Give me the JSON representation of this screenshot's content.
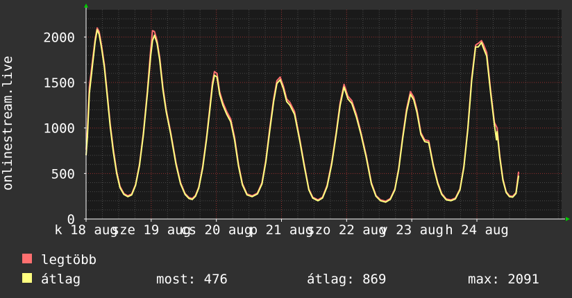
{
  "chart_data": {
    "type": "line",
    "ylabel": "onlinestream.live",
    "ylim": [
      0,
      2300
    ],
    "yticks": [
      0,
      500,
      1000,
      1500,
      2000
    ],
    "xlim": [
      0,
      7.3
    ],
    "xtick_labels": [
      {
        "pos": 0,
        "label": "k 18 aug"
      },
      {
        "pos": 1,
        "label": "sze 19 aug"
      },
      {
        "pos": 2,
        "label": "cs 20 aug"
      },
      {
        "pos": 3,
        "label": "p 21 aug"
      },
      {
        "pos": 4,
        "label": "szo 22 aug"
      },
      {
        "pos": 5,
        "label": "v 23 aug"
      },
      {
        "pos": 6,
        "label": "h 24 aug"
      }
    ],
    "colors": {
      "background": "#303030",
      "plot_bg": "#1a1a1a",
      "grid_major": "#ff4040",
      "grid_minor": "#4a4a4a",
      "max_series": "#ff7070",
      "avg_series": "#ffff80",
      "axis": "#ffffff",
      "arrow": "#00cc00",
      "text": "#ffffff"
    },
    "series": [
      {
        "name": "legtöbb",
        "color": "#ff7070",
        "points": [
          [
            0.0,
            760
          ],
          [
            0.02,
            980
          ],
          [
            0.05,
            1450
          ],
          [
            0.1,
            1750
          ],
          [
            0.14,
            1980
          ],
          [
            0.17,
            2100
          ],
          [
            0.2,
            2060
          ],
          [
            0.24,
            1900
          ],
          [
            0.28,
            1700
          ],
          [
            0.32,
            1420
          ],
          [
            0.37,
            1050
          ],
          [
            0.42,
            760
          ],
          [
            0.47,
            520
          ],
          [
            0.52,
            360
          ],
          [
            0.58,
            280
          ],
          [
            0.64,
            255
          ],
          [
            0.7,
            275
          ],
          [
            0.76,
            380
          ],
          [
            0.82,
            600
          ],
          [
            0.88,
            950
          ],
          [
            0.94,
            1400
          ],
          [
            0.99,
            1850
          ],
          [
            1.02,
            2070
          ],
          [
            1.05,
            2060
          ],
          [
            1.09,
            1960
          ],
          [
            1.13,
            1780
          ],
          [
            1.18,
            1450
          ],
          [
            1.23,
            1200
          ],
          [
            1.3,
            950
          ],
          [
            1.38,
            620
          ],
          [
            1.45,
            400
          ],
          [
            1.52,
            280
          ],
          [
            1.58,
            235
          ],
          [
            1.63,
            225
          ],
          [
            1.68,
            260
          ],
          [
            1.73,
            350
          ],
          [
            1.79,
            580
          ],
          [
            1.85,
            900
          ],
          [
            1.9,
            1230
          ],
          [
            1.94,
            1500
          ],
          [
            1.97,
            1620
          ],
          [
            2.01,
            1600
          ],
          [
            2.05,
            1400
          ],
          [
            2.1,
            1280
          ],
          [
            2.16,
            1180
          ],
          [
            2.22,
            1100
          ],
          [
            2.28,
            900
          ],
          [
            2.34,
            600
          ],
          [
            2.4,
            390
          ],
          [
            2.47,
            275
          ],
          [
            2.55,
            255
          ],
          [
            2.63,
            285
          ],
          [
            2.7,
            400
          ],
          [
            2.76,
            650
          ],
          [
            2.82,
            1000
          ],
          [
            2.88,
            1320
          ],
          [
            2.93,
            1520
          ],
          [
            2.98,
            1560
          ],
          [
            3.03,
            1460
          ],
          [
            3.08,
            1320
          ],
          [
            3.13,
            1280
          ],
          [
            3.2,
            1180
          ],
          [
            3.28,
            880
          ],
          [
            3.35,
            600
          ],
          [
            3.42,
            330
          ],
          [
            3.48,
            240
          ],
          [
            3.56,
            210
          ],
          [
            3.63,
            240
          ],
          [
            3.7,
            370
          ],
          [
            3.77,
            620
          ],
          [
            3.84,
            950
          ],
          [
            3.9,
            1280
          ],
          [
            3.96,
            1480
          ],
          [
            4.02,
            1350
          ],
          [
            4.08,
            1300
          ],
          [
            4.15,
            1150
          ],
          [
            4.22,
            950
          ],
          [
            4.3,
            700
          ],
          [
            4.38,
            400
          ],
          [
            4.45,
            260
          ],
          [
            4.52,
            210
          ],
          [
            4.6,
            195
          ],
          [
            4.67,
            225
          ],
          [
            4.74,
            330
          ],
          [
            4.8,
            560
          ],
          [
            4.86,
            900
          ],
          [
            4.92,
            1210
          ],
          [
            4.98,
            1400
          ],
          [
            5.03,
            1340
          ],
          [
            5.08,
            1200
          ],
          [
            5.14,
            950
          ],
          [
            5.2,
            870
          ],
          [
            5.26,
            860
          ],
          [
            5.33,
            600
          ],
          [
            5.4,
            400
          ],
          [
            5.46,
            280
          ],
          [
            5.53,
            220
          ],
          [
            5.6,
            210
          ],
          [
            5.67,
            230
          ],
          [
            5.74,
            330
          ],
          [
            5.8,
            580
          ],
          [
            5.86,
            1000
          ],
          [
            5.92,
            1550
          ],
          [
            5.98,
            1910
          ],
          [
            6.02,
            1930
          ],
          [
            6.07,
            1960
          ],
          [
            6.1,
            1920
          ],
          [
            6.15,
            1830
          ],
          [
            6.21,
            1420
          ],
          [
            6.27,
            1060
          ],
          [
            6.31,
            1000
          ],
          [
            6.35,
            700
          ],
          [
            6.4,
            440
          ],
          [
            6.45,
            300
          ],
          [
            6.5,
            255
          ],
          [
            6.55,
            250
          ],
          [
            6.6,
            290
          ],
          [
            6.64,
            520
          ]
        ]
      },
      {
        "name": "átlag",
        "color": "#ffff80",
        "points": [
          [
            0.0,
            700
          ],
          [
            0.02,
            900
          ],
          [
            0.05,
            1380
          ],
          [
            0.1,
            1700
          ],
          [
            0.14,
            1950
          ],
          [
            0.17,
            2080
          ],
          [
            0.2,
            2030
          ],
          [
            0.24,
            1870
          ],
          [
            0.28,
            1670
          ],
          [
            0.32,
            1390
          ],
          [
            0.37,
            1020
          ],
          [
            0.42,
            730
          ],
          [
            0.47,
            500
          ],
          [
            0.52,
            345
          ],
          [
            0.58,
            270
          ],
          [
            0.64,
            245
          ],
          [
            0.7,
            265
          ],
          [
            0.76,
            370
          ],
          [
            0.82,
            585
          ],
          [
            0.88,
            930
          ],
          [
            0.94,
            1370
          ],
          [
            0.99,
            1780
          ],
          [
            1.02,
            1960
          ],
          [
            1.05,
            2020
          ],
          [
            1.09,
            1930
          ],
          [
            1.13,
            1750
          ],
          [
            1.18,
            1420
          ],
          [
            1.23,
            1180
          ],
          [
            1.3,
            930
          ],
          [
            1.38,
            600
          ],
          [
            1.45,
            385
          ],
          [
            1.52,
            270
          ],
          [
            1.58,
            225
          ],
          [
            1.63,
            215
          ],
          [
            1.68,
            250
          ],
          [
            1.73,
            340
          ],
          [
            1.79,
            560
          ],
          [
            1.85,
            880
          ],
          [
            1.9,
            1200
          ],
          [
            1.94,
            1460
          ],
          [
            1.97,
            1580
          ],
          [
            2.01,
            1560
          ],
          [
            2.05,
            1370
          ],
          [
            2.1,
            1250
          ],
          [
            2.16,
            1150
          ],
          [
            2.22,
            1070
          ],
          [
            2.28,
            870
          ],
          [
            2.34,
            580
          ],
          [
            2.4,
            375
          ],
          [
            2.47,
            265
          ],
          [
            2.55,
            245
          ],
          [
            2.63,
            275
          ],
          [
            2.7,
            385
          ],
          [
            2.76,
            630
          ],
          [
            2.82,
            970
          ],
          [
            2.88,
            1290
          ],
          [
            2.93,
            1490
          ],
          [
            2.98,
            1530
          ],
          [
            3.03,
            1430
          ],
          [
            3.08,
            1290
          ],
          [
            3.13,
            1250
          ],
          [
            3.2,
            1150
          ],
          [
            3.28,
            860
          ],
          [
            3.35,
            580
          ],
          [
            3.42,
            320
          ],
          [
            3.48,
            230
          ],
          [
            3.56,
            200
          ],
          [
            3.63,
            230
          ],
          [
            3.7,
            355
          ],
          [
            3.77,
            600
          ],
          [
            3.84,
            930
          ],
          [
            3.9,
            1250
          ],
          [
            3.96,
            1450
          ],
          [
            4.02,
            1320
          ],
          [
            4.08,
            1270
          ],
          [
            4.15,
            1120
          ],
          [
            4.22,
            930
          ],
          [
            4.3,
            680
          ],
          [
            4.38,
            385
          ],
          [
            4.45,
            250
          ],
          [
            4.52,
            200
          ],
          [
            4.6,
            185
          ],
          [
            4.67,
            215
          ],
          [
            4.74,
            320
          ],
          [
            4.8,
            545
          ],
          [
            4.86,
            880
          ],
          [
            4.92,
            1180
          ],
          [
            4.98,
            1370
          ],
          [
            5.03,
            1310
          ],
          [
            5.08,
            1170
          ],
          [
            5.14,
            930
          ],
          [
            5.2,
            850
          ],
          [
            5.26,
            840
          ],
          [
            5.33,
            585
          ],
          [
            5.4,
            385
          ],
          [
            5.46,
            270
          ],
          [
            5.53,
            210
          ],
          [
            5.6,
            200
          ],
          [
            5.67,
            220
          ],
          [
            5.74,
            320
          ],
          [
            5.8,
            565
          ],
          [
            5.86,
            980
          ],
          [
            5.92,
            1520
          ],
          [
            5.98,
            1890
          ],
          [
            6.02,
            1890
          ],
          [
            6.07,
            1940
          ],
          [
            6.1,
            1880
          ],
          [
            6.15,
            1790
          ],
          [
            6.21,
            1390
          ],
          [
            6.27,
            1030
          ],
          [
            6.3,
            870
          ],
          [
            6.31,
            960
          ],
          [
            6.35,
            680
          ],
          [
            6.4,
            425
          ],
          [
            6.45,
            290
          ],
          [
            6.5,
            245
          ],
          [
            6.55,
            240
          ],
          [
            6.6,
            280
          ],
          [
            6.64,
            476
          ]
        ]
      }
    ]
  },
  "legend": {
    "items": [
      {
        "label": "legtöbb",
        "color": "#ff7070"
      },
      {
        "label": "átlag",
        "color": "#ffff80"
      }
    ],
    "stats": {
      "current": "most: 476",
      "average": "átlag: 869",
      "max": "max: 2091"
    }
  }
}
